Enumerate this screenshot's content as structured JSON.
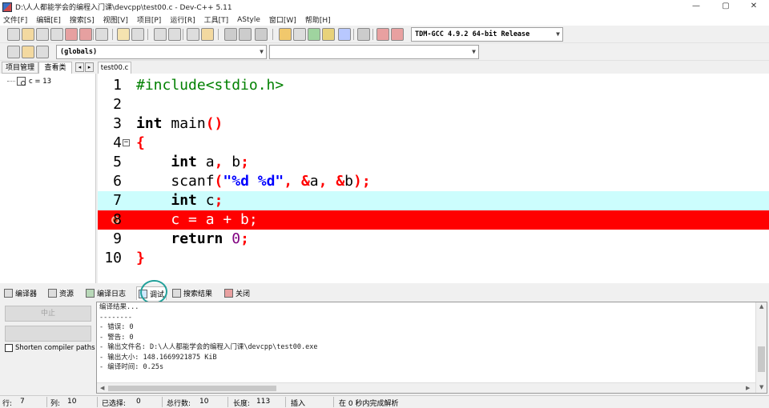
{
  "window": {
    "title": "D:\\人人都能学会的编程入门课\\devcpp\\test00.c - Dev-C++ 5.11",
    "controls": {
      "minimize": "—",
      "maximize": "▢",
      "close": "✕"
    }
  },
  "menu": [
    "文件[F]",
    "编辑[E]",
    "搜索[S]",
    "视图[V]",
    "项目[P]",
    "运行[R]",
    "工具[T]",
    "AStyle",
    "窗口[W]",
    "帮助[H]"
  ],
  "toolbar": {
    "compiler": "TDM-GCC 4.9.2 64-bit Release",
    "scope": "(globals)",
    "member": ""
  },
  "left_tabs": [
    "项目管理",
    "查看类"
  ],
  "nav": {
    "prev": "◂",
    "next": "▸"
  },
  "watch": {
    "label": "c = 13"
  },
  "editor": {
    "tab": "test00.c",
    "current_line": 7,
    "breakpoint_line": 8,
    "fold_marker": "⊟",
    "lines": [
      {
        "n": "1",
        "html": "<span class='pp'>#include&lt;stdio.h&gt;</span>"
      },
      {
        "n": "2",
        "html": ""
      },
      {
        "n": "3",
        "html": "<span class='kw'>int</span> main<span class='sym'>()</span>"
      },
      {
        "n": "4",
        "html": "<span class='sym'>{</span>"
      },
      {
        "n": "5",
        "html": "    <span class='kw'>int</span> a<span class='sym'>,</span> b<span class='sym'>;</span>"
      },
      {
        "n": "6",
        "html": "    scanf<span class='sym'>(</span><span class='str'>\"%d %d\"</span><span class='sym'>,</span> <span class='sym'>&amp;</span>a<span class='sym'>,</span> <span class='sym'>&amp;</span>b<span class='sym'>);</span>"
      },
      {
        "n": "7",
        "html": "    <span class='kw'>int</span> c<span class='sym'>;</span>"
      },
      {
        "n": "8",
        "html": "    c = a + b;"
      },
      {
        "n": "9",
        "html": "    <span class='kw'>return</span> <span class='num'>0</span><span class='sym'>;</span>"
      },
      {
        "n": "10",
        "html": "<span class='sym'>}</span>"
      }
    ]
  },
  "bottom_tabs": [
    "编译器",
    "资源",
    "编译日志",
    "调试",
    "搜索结果",
    "关闭"
  ],
  "active_bottom_tab": "调试",
  "debug_panel": {
    "stop_button": "中止",
    "shorten_label": "Shorten compiler paths"
  },
  "output": {
    "lines": [
      "编译结果...",
      "--------",
      "- 错误: 0",
      "- 警告: 0",
      "- 输出文件名: D:\\人人都能学会的编程入门课\\devcpp\\test00.exe",
      "- 输出大小: 148.1669921875 KiB",
      "- 编译时间: 0.25s"
    ]
  },
  "status": {
    "row_label": "行:",
    "row": "7",
    "col_label": "列:",
    "col": "10",
    "sel_label": "已选择:",
    "sel": "0",
    "total_label": "总行数:",
    "total": "10",
    "len_label": "长度:",
    "len": "113",
    "mode": "插入",
    "parse": "在 0 秒内完成解析"
  }
}
